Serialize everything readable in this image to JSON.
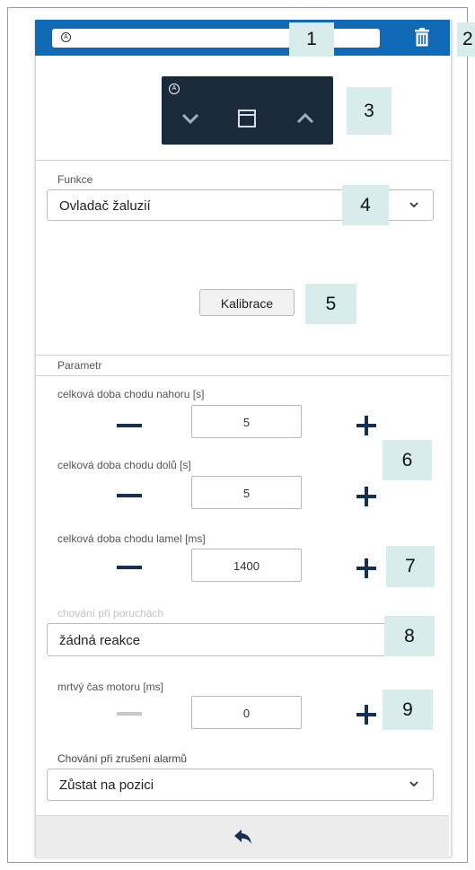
{
  "header": {
    "name_value": "",
    "auto_icon_glyph": "A",
    "delete_icon": "trash-icon",
    "bar_color": "#1069b5"
  },
  "control_preview": {
    "auto_icon_glyph": "A",
    "down_icon": "chevron-down-icon",
    "stop_icon": "blind-stop-icon",
    "up_icon": "chevron-up-icon"
  },
  "function": {
    "label": "Funkce",
    "selected": "Ovladač žaluzií"
  },
  "calibration": {
    "button_label": "Kalibrace"
  },
  "parameters": {
    "section_title": "Parametr",
    "up_time": {
      "label": "celková doba chodu nahoru [s]",
      "value": "5"
    },
    "down_time": {
      "label": "celková doba chodu dolů [s]",
      "value": "5"
    },
    "slat_time": {
      "label": "celková doba chodu lamel [ms]",
      "value": "1400"
    },
    "fault_behavior": {
      "label": "chování při poruchách",
      "selected": "žádná reakce"
    },
    "dead_time": {
      "label": "mrtvý čas motoru [ms]",
      "value": "0"
    },
    "alarm_cancel": {
      "label": "Chování při zrušení alarmů",
      "selected": "Zůstat na pozici"
    }
  },
  "footer": {
    "back_icon": "back-arrow-icon"
  },
  "callouts": [
    "1",
    "2",
    "3",
    "4",
    "5",
    "6",
    "7",
    "8",
    "9"
  ]
}
